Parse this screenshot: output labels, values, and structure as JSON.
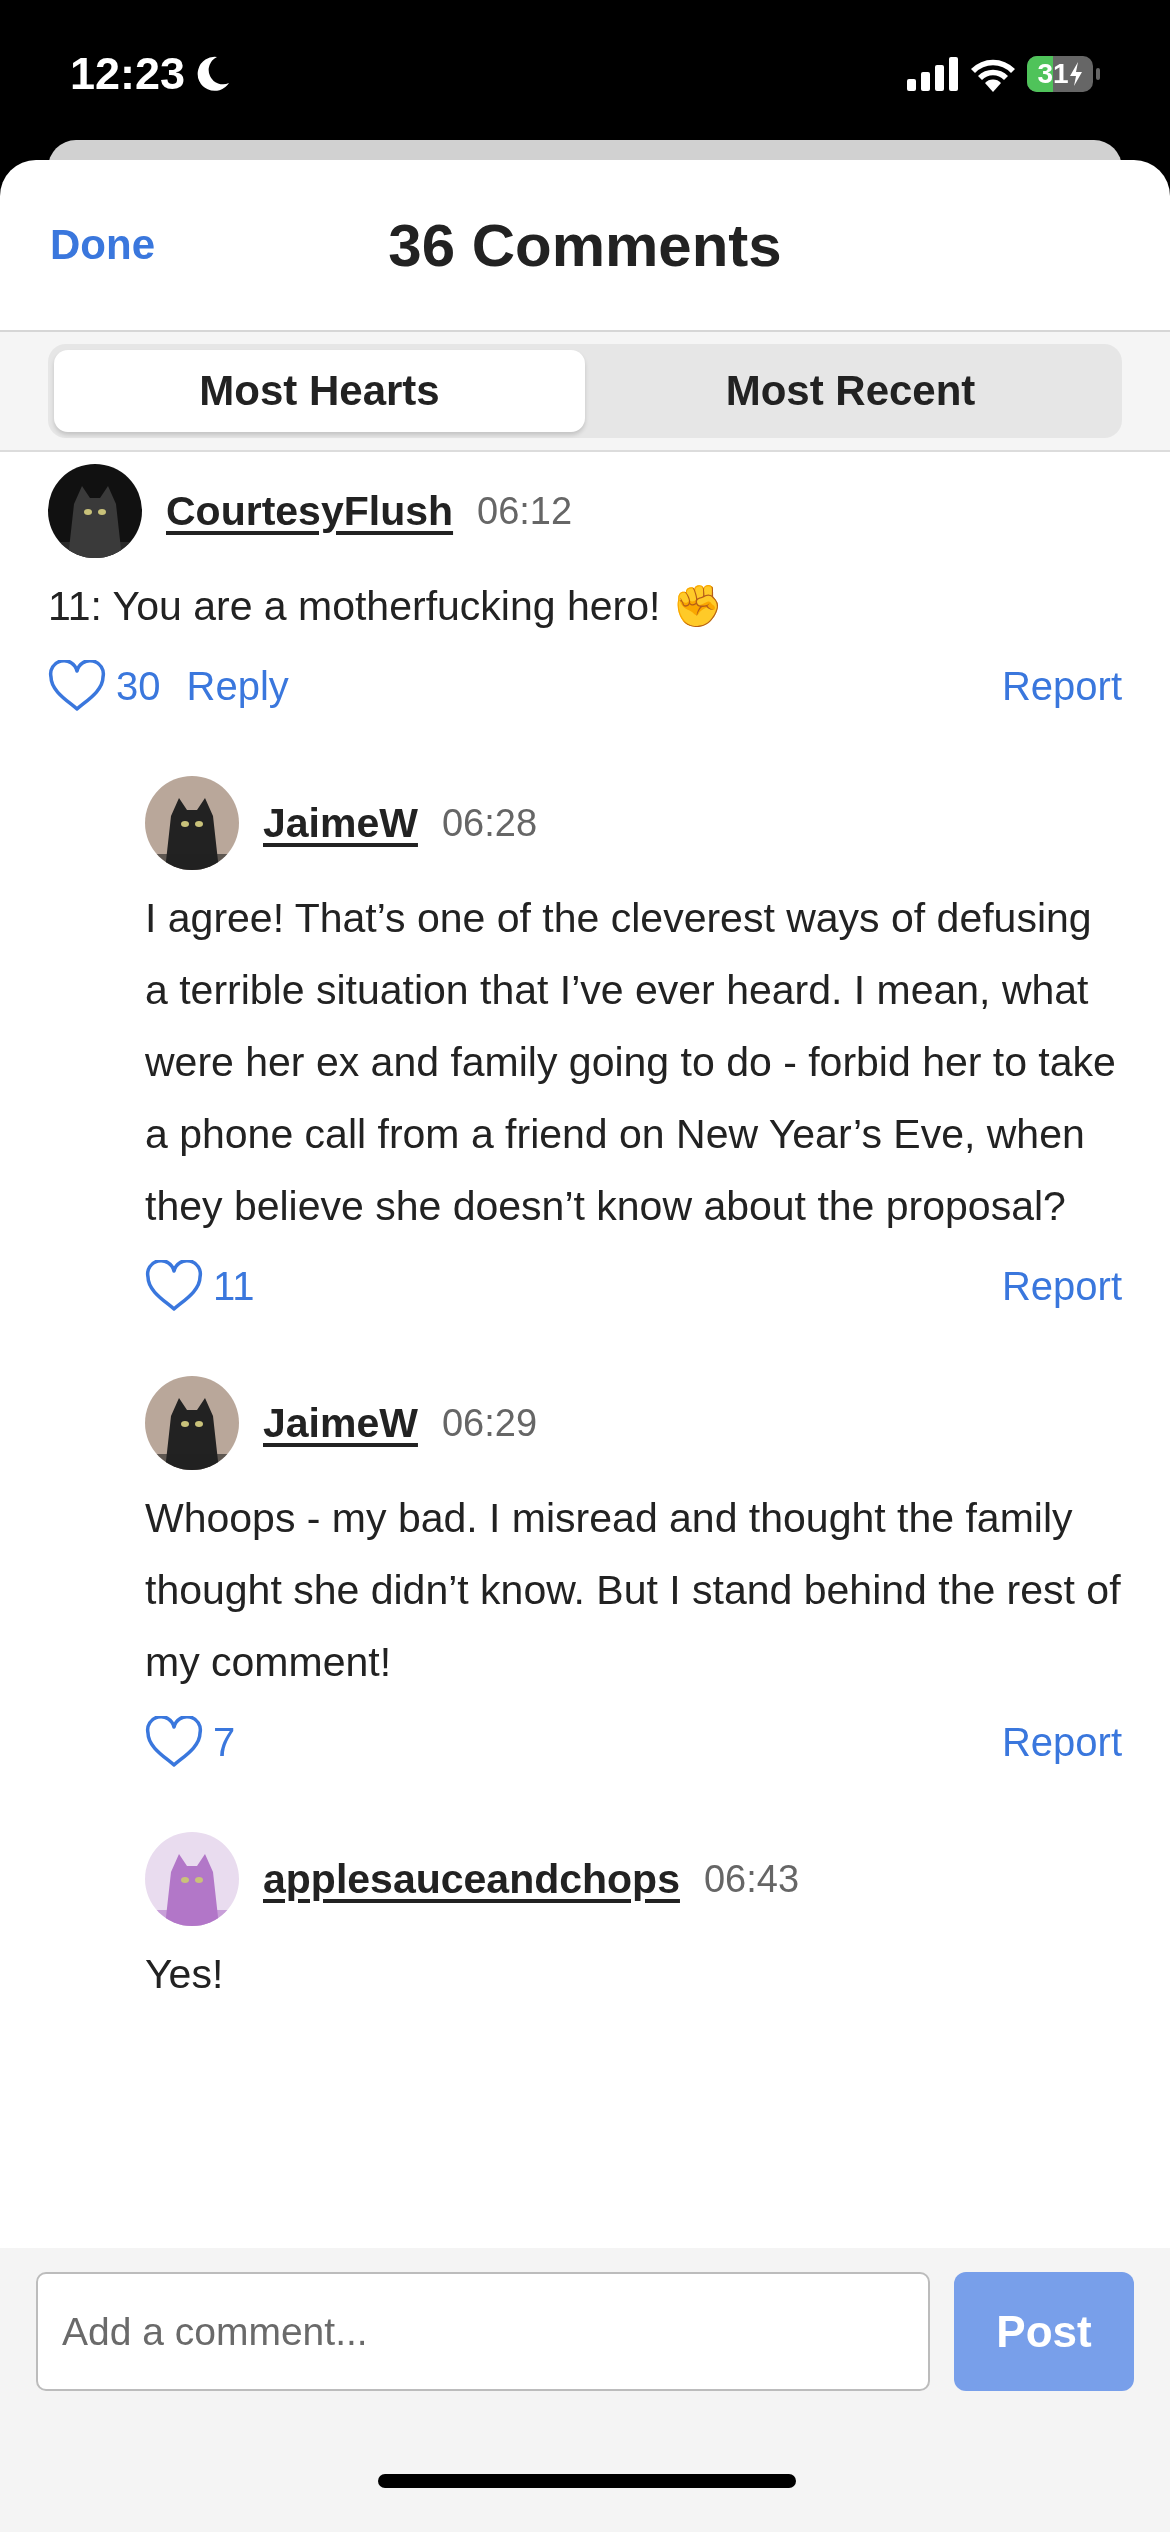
{
  "status_bar": {
    "time": "12:23",
    "battery": "31"
  },
  "header": {
    "done": "Done",
    "title": "36 Comments"
  },
  "sort_tabs": [
    {
      "label": "Most Hearts",
      "selected": true
    },
    {
      "label": "Most Recent",
      "selected": false
    }
  ],
  "comments": [
    {
      "kind": "comment",
      "user": "CourtesyFlush",
      "time": "06:12",
      "text": "11: You are a motherfucking hero! ✊",
      "hearts": "30",
      "reply": "Reply",
      "report": "Report"
    },
    {
      "kind": "reply",
      "user": "JaimeW",
      "time": "06:28",
      "text": "I agree! That’s one of the cleverest ways of defusing a terrible situation that I’ve ever heard. I mean, what were her ex and family going to do - forbid her to take a phone call from a friend on New Year’s Eve, when they believe she doesn’t know about the proposal?",
      "hearts": "11",
      "report": "Report"
    },
    {
      "kind": "reply",
      "user": "JaimeW",
      "time": "06:29",
      "text": "Whoops - my bad. I misread and thought the family thought she didn’t know. But I stand behind the rest of my comment!",
      "hearts": "7",
      "report": "Report"
    },
    {
      "kind": "reply",
      "user": "applesauceandchops",
      "time": "06:43",
      "text": "Yes!"
    }
  ],
  "composer": {
    "placeholder": "Add a comment...",
    "button": "Post"
  }
}
